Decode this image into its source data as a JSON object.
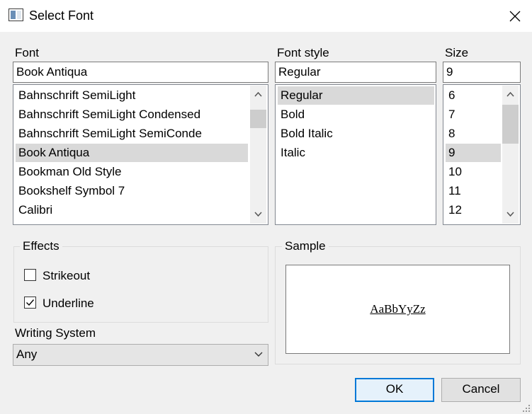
{
  "window": {
    "title": "Select Font",
    "icon": "app-window-icon"
  },
  "font": {
    "label": "Font",
    "value": "Book Antiqua",
    "items": [
      "Bahnschrift SemiLight",
      "Bahnschrift SemiLight Condensed",
      "Bahnschrift SemiLight SemiConde",
      "Book Antiqua",
      "Bookman Old Style",
      "Bookshelf Symbol 7",
      "Calibri"
    ],
    "selected": "Book Antiqua"
  },
  "style": {
    "label": "Font style",
    "value": "Regular",
    "items": [
      "Regular",
      "Bold",
      "Bold Italic",
      "Italic"
    ],
    "selected": "Regular"
  },
  "size": {
    "label": "Size",
    "value": "9",
    "items": [
      "6",
      "7",
      "8",
      "9",
      "10",
      "11",
      "12"
    ],
    "selected": "9"
  },
  "effects": {
    "title": "Effects",
    "strikeout": {
      "label": "Strikeout",
      "checked": false
    },
    "underline": {
      "label": "Underline",
      "checked": true
    }
  },
  "writing_system": {
    "label": "Writing System",
    "value": "Any"
  },
  "sample": {
    "title": "Sample",
    "text": "AaBbYyZz"
  },
  "buttons": {
    "ok": "OK",
    "cancel": "Cancel"
  },
  "colors": {
    "accent": "#0078d7",
    "selection": "#d9d9d9"
  }
}
